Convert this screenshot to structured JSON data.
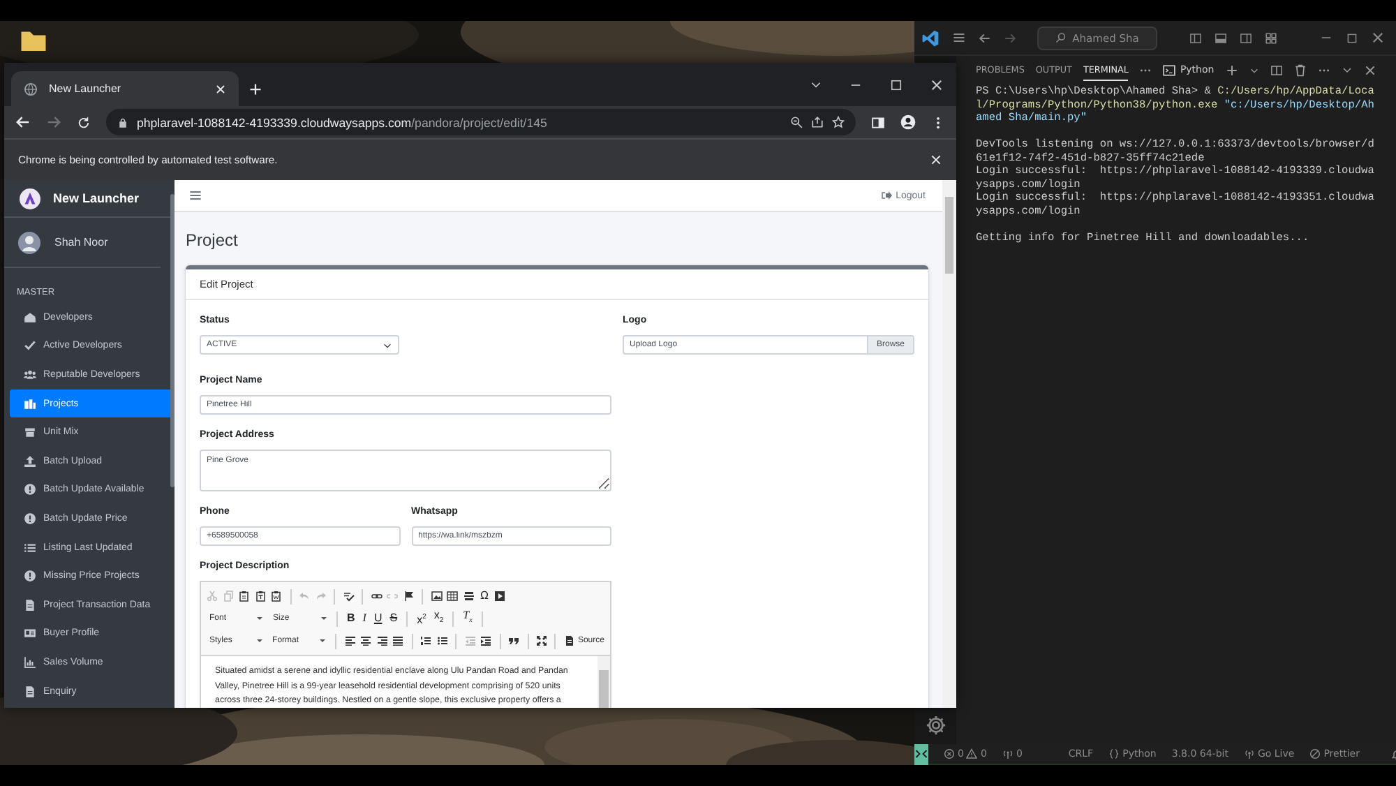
{
  "browser": {
    "tabs": [
      {
        "title": "New Launcher",
        "selected": true
      }
    ],
    "forward_disabled": true,
    "url": {
      "host": "phplaravel-1088142-4193339.cloudwaysapps.com",
      "path": "/pandora/project/edit/145"
    },
    "infobar": "Chrome is being controlled by automated test software."
  },
  "app": {
    "brand": "New Launcher",
    "user": "Shah Noor",
    "section": "MASTER",
    "menu": [
      {
        "label": "Developers",
        "selected": false
      },
      {
        "label": "Active Developers",
        "selected": false
      },
      {
        "label": "Reputable Developers",
        "selected": false
      },
      {
        "label": "Projects",
        "selected": true
      },
      {
        "label": "Unit Mix",
        "selected": false
      },
      {
        "label": "Batch Upload",
        "selected": false
      },
      {
        "label": "Batch Update Available",
        "selected": false
      },
      {
        "label": "Batch Update Price",
        "selected": false
      },
      {
        "label": "Listing Last Updated",
        "selected": false
      },
      {
        "label": "Missing Price Projects",
        "selected": false
      },
      {
        "label": "Project Transaction Data",
        "selected": false
      },
      {
        "label": "Buyer Profile",
        "selected": false
      },
      {
        "label": "Sales Volume",
        "selected": false
      },
      {
        "label": "Enquiry",
        "selected": false
      }
    ],
    "logout": "Logout",
    "page_title": "Project",
    "card_title": "Edit Project",
    "form": {
      "status": {
        "label": "Status",
        "value": "ACTIVE"
      },
      "logo": {
        "label": "Logo",
        "placeholder": "Upload Logo",
        "button": "Browse"
      },
      "name": {
        "label": "Project Name",
        "value": "Pinetree Hill"
      },
      "address": {
        "label": "Project Address",
        "value": "Pine Grove"
      },
      "phone": {
        "label": "Phone",
        "value": "+6589500058"
      },
      "whatsapp": {
        "label": "Whatsapp",
        "value": "https://wa.link/mszbzm"
      },
      "description": {
        "label": "Project Description",
        "toolbar": [
          [
            {
              "kind": "icon",
              "disabled": true
            },
            {
              "kind": "icon",
              "disabled": true
            },
            {
              "kind": "icon",
              "disabled": false
            },
            {
              "kind": "icon",
              "disabled": false
            },
            {
              "kind": "icon",
              "disabled": false
            },
            {
              "kind": "sep"
            },
            {
              "kind": "icon",
              "disabled": true
            },
            {
              "kind": "icon",
              "disabled": true
            },
            {
              "kind": "sep"
            },
            {
              "kind": "icon",
              "disabled": false
            },
            {
              "kind": "sep"
            },
            {
              "kind": "icon",
              "disabled": false
            },
            {
              "kind": "icon",
              "disabled": true
            },
            {
              "kind": "icon",
              "disabled": false
            },
            {
              "kind": "sep"
            },
            {
              "kind": "icon",
              "disabled": false
            },
            {
              "kind": "icon",
              "disabled": false
            },
            {
              "kind": "icon",
              "disabled": false
            },
            {
              "kind": "text",
              "text": "Ω"
            },
            {
              "kind": "icon",
              "disabled": false
            }
          ],
          [
            {
              "kind": "combo",
              "text": "Font"
            },
            {
              "kind": "combo",
              "text": "Size"
            },
            {
              "kind": "sep"
            },
            {
              "kind": "bold",
              "text": "B"
            },
            {
              "kind": "italic",
              "text": "I"
            },
            {
              "kind": "underline",
              "text": "U"
            },
            {
              "kind": "strike",
              "text": "S"
            },
            {
              "kind": "sep"
            },
            {
              "kind": "text",
              "text": "x$^{2}$"
            },
            {
              "kind": "text",
              "text": "x$_{2}$"
            },
            {
              "kind": "sep"
            },
            {
              "kind": "italic",
              "text": "T$_{x}$"
            },
            {
              "kind": "sep"
            }
          ],
          [
            {
              "kind": "combo",
              "text": "Styles"
            },
            {
              "kind": "combo",
              "text": "Format"
            },
            {
              "kind": "sep"
            },
            {
              "kind": "icon",
              "disabled": false
            },
            {
              "kind": "icon",
              "disabled": false
            },
            {
              "kind": "icon",
              "disabled": false
            },
            {
              "kind": "icon",
              "disabled": false
            },
            {
              "kind": "sep"
            },
            {
              "kind": "icon",
              "disabled": false
            },
            {
              "kind": "icon",
              "disabled": false
            },
            {
              "kind": "sep"
            },
            {
              "kind": "icon",
              "disabled": true
            },
            {
              "kind": "icon",
              "disabled": false
            },
            {
              "kind": "sep"
            },
            {
              "kind": "icon",
              "disabled": false
            },
            {
              "kind": "sep"
            },
            {
              "kind": "icon",
              "disabled": false
            },
            {
              "kind": "sep"
            },
            {
              "kind": "button",
              "text": "Source"
            }
          ]
        ],
        "text": "Situated amidst a serene and idyllic residential enclave along Ulu Pandan Road and Pandan Valley, Pinetree Hill is a 99-year leasehold residential development comprising of 520 units across three 24-storey buildings. Nestled on a gentle slope, this exclusive property offers a"
      }
    }
  },
  "vscode": {
    "search": "Ahamed Sha",
    "panel_tabs": [
      {
        "label": "PROBLEMS",
        "selected": false
      },
      {
        "label": "OUTPUT",
        "selected": false
      },
      {
        "label": "TERMINAL",
        "selected": true
      }
    ],
    "terminal_name": "Python",
    "terminal": [
      [
        [
          {
            "kind": "plain",
            "text": "PS C:\\Users\\hp\\Desktop\\Ahamed Sha> & "
          },
          {
            "kind": "command",
            "text": "C:/Users/hp/AppData/Loca"
          }
        ],
        [
          {
            "kind": "command",
            "text": "l/Programs/Python/Python38/python.exe "
          },
          {
            "kind": "string",
            "text": "\"c:/Users/hp/Desktop/Ah"
          }
        ],
        [
          {
            "kind": "string",
            "text": "amed Sha/main.py\""
          }
        ]
      ],
      [
        [
          {
            "kind": "plain",
            "text": "DevTools listening on ws://127.0.0.1:63373/devtools/browser/d"
          }
        ],
        [
          {
            "kind": "plain",
            "text": "61e1f12-74f2-451d-b827-35ff74c21ede"
          }
        ],
        [
          {
            "kind": "plain",
            "text": "Login successful:  https://phplaravel-1088142-4193339.cloudwa"
          }
        ],
        [
          {
            "kind": "plain",
            "text": "ysapps.com/login"
          }
        ],
        [
          {
            "kind": "plain",
            "text": "Login successful:  https://phplaravel-1088142-4193351.cloudwa"
          }
        ],
        [
          {
            "kind": "plain",
            "text": "ysapps.com/login"
          }
        ]
      ],
      [
        [
          {
            "kind": "plain",
            "text": "Getting info for Pinetree Hill and downloadables..."
          }
        ]
      ]
    ],
    "status": [
      {
        "kind": "errors",
        "text": "0"
      },
      {
        "kind": "warnings",
        "text": "0"
      },
      {
        "kind": "ports",
        "text": "0"
      },
      {
        "kind": "plain",
        "text": "CRLF"
      },
      {
        "kind": "language",
        "text": "Python"
      },
      {
        "kind": "plain",
        "text": "3.8.0 64-bit"
      },
      {
        "kind": "golive",
        "text": "Go Live"
      },
      {
        "kind": "prettier",
        "text": "Prettier"
      }
    ]
  }
}
